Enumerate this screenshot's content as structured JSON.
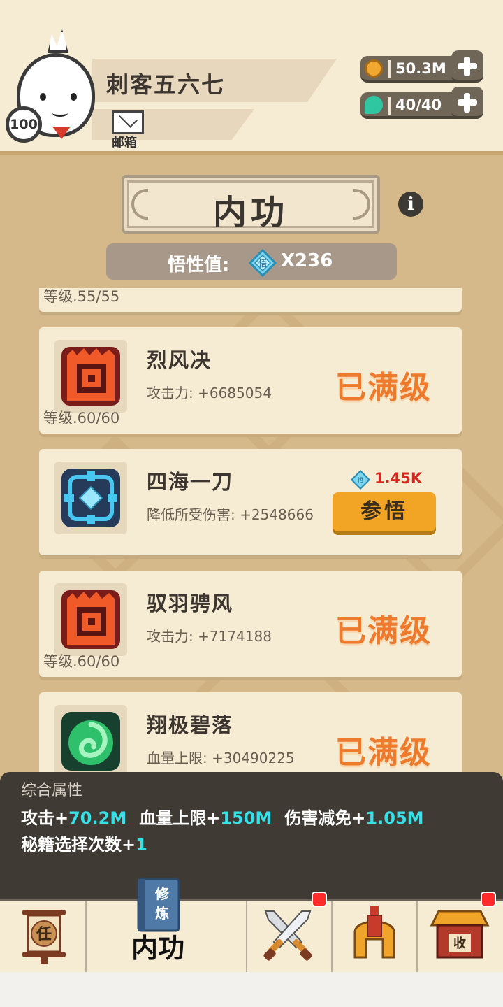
{
  "player": {
    "name": "刺客五六七",
    "level": "100",
    "mail_label": "邮箱"
  },
  "resources": {
    "coins": "50.3M",
    "energy": "40/40"
  },
  "page": {
    "title": "内功",
    "wuxing_label": "悟性值:",
    "wuxing_value": "X236"
  },
  "skills": [
    {
      "name": "",
      "stat": "",
      "level": "等级.55/55",
      "state": "partial"
    },
    {
      "name": "烈风决",
      "stat": "攻击力: +6685054",
      "level": "等级.60/60",
      "status": "已满级",
      "icon": "fire-scroll-icon"
    },
    {
      "name": "四海一刀",
      "stat": "降低所受伤害: +2548666",
      "cost": "1.45K",
      "action": "参悟",
      "icon": "blue-crystal-icon"
    },
    {
      "name": "驭羽骋风",
      "stat": "攻击力: +7174188",
      "level": "等级.60/60",
      "status": "已满级",
      "icon": "fire-scroll-icon"
    },
    {
      "name": "翔极碧落",
      "stat": "血量上限: +30490225",
      "status": "已满级",
      "icon": "green-swirl-icon"
    }
  ],
  "attributes": {
    "title": "综合属性",
    "line1": [
      {
        "label": "攻击+",
        "value": "70.2M"
      },
      {
        "label": "血量上限+",
        "value": "150M"
      },
      {
        "label": "伤害减免+",
        "value": "1.05M"
      }
    ],
    "line2": [
      {
        "label": "秘籍选择次数+",
        "value": "1"
      }
    ]
  },
  "nav": {
    "task_char": "任",
    "book_chars": "修炼",
    "active_label": "内功",
    "shop_char": "收"
  },
  "colors": {
    "accent_orange": "#ee7a2c",
    "button_yellow": "#f2a524",
    "stat_cyan": "#35e0e6",
    "cost_red": "#d3281f"
  }
}
